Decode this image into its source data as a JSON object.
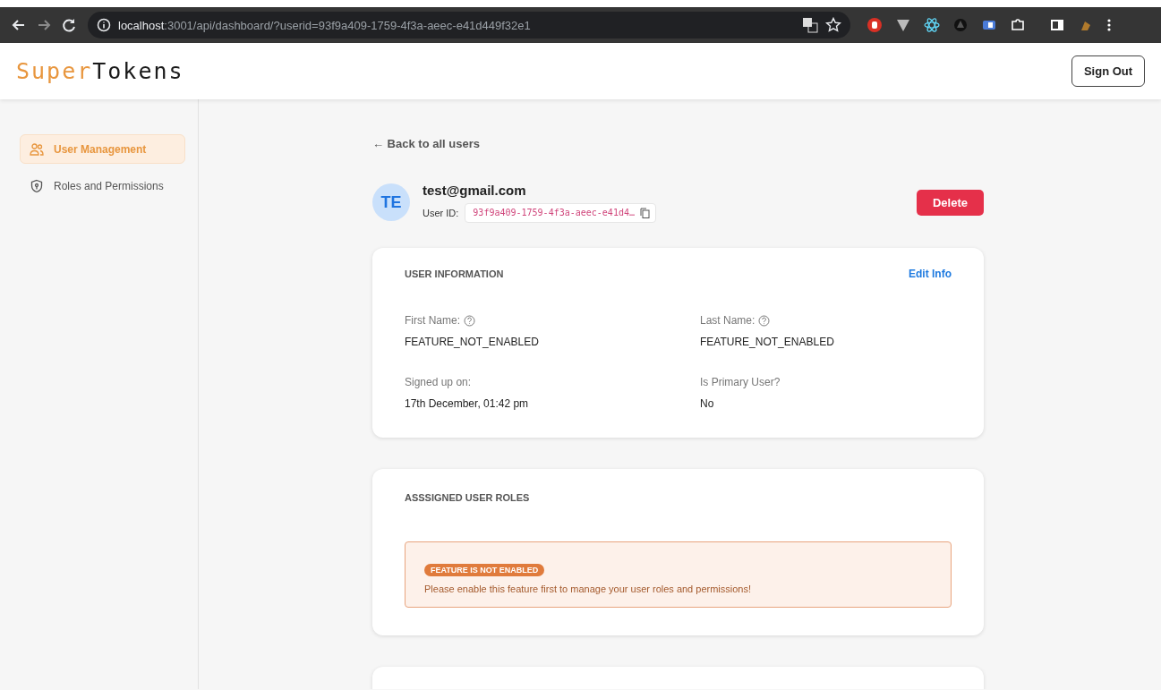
{
  "browser": {
    "url_host": "localhost",
    "url_rest": ":3001/api/dashboard/?userid=93f9a409-1759-4f3a-aeec-e41d449f32e1"
  },
  "header": {
    "logo_part_1": "Super",
    "logo_part_2": "Tokens",
    "sign_out": "Sign Out"
  },
  "sidebar": {
    "items": [
      {
        "label": "User Management",
        "selected": true
      },
      {
        "label": "Roles and Permissions",
        "selected": false
      }
    ]
  },
  "back_link": "← Back to all users",
  "user": {
    "initials": "TE",
    "email": "test@gmail.com",
    "id_label": "User ID:",
    "id_value": "93f9a409-1759-4f3a-aeec-e41d4…",
    "delete": "Delete"
  },
  "user_information": {
    "title": "USER INFORMATION",
    "edit": "Edit Info",
    "fields": [
      {
        "label": "First Name:",
        "help": true,
        "value": "FEATURE_NOT_ENABLED"
      },
      {
        "label": "Last Name:",
        "help": true,
        "value": "FEATURE_NOT_ENABLED"
      },
      {
        "label": "Signed up on:",
        "help": false,
        "value": "17th December, 01:42 pm"
      },
      {
        "label": "Is Primary User?",
        "help": false,
        "value": "No"
      }
    ]
  },
  "roles": {
    "title": "ASSSIGNED USER ROLES",
    "badge": "FEATURE IS NOT ENABLED",
    "message": "Please enable this feature first to manage your user roles and permissions!"
  }
}
